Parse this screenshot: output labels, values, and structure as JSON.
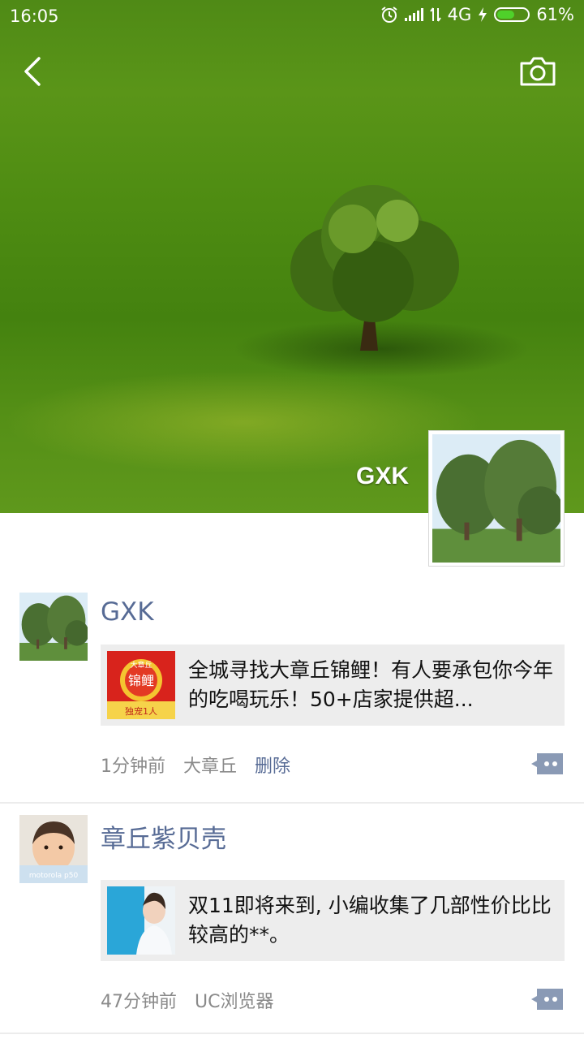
{
  "status_bar": {
    "time": "16:05",
    "network": "4G",
    "battery": "61%",
    "battery_level": 0.61
  },
  "header": {
    "back_icon": "chevron-left-icon",
    "camera_icon": "camera-icon"
  },
  "profile": {
    "name": "GXK"
  },
  "posts": [
    {
      "name": "GXK",
      "share_text": "全城寻找大章丘锦鲤！有人要承包你今年的吃喝玩乐！50+店家提供超...",
      "thumb_texts": [
        "大章丘",
        "锦鲤",
        "独宠1人"
      ],
      "time": "1分钟前",
      "location": "大章丘",
      "delete_label": "删除"
    },
    {
      "name": "章丘紫贝壳",
      "avatar_text": "motorola p50",
      "share_text": "双11即将来到, 小编收集了几部性价比比较高的**。",
      "time": "47分钟前",
      "source": "UC浏览器"
    }
  ],
  "colors": {
    "link": "#576b95",
    "meta": "#8a8a8a",
    "card_bg": "#ededed",
    "battery": "#4fd12a"
  }
}
